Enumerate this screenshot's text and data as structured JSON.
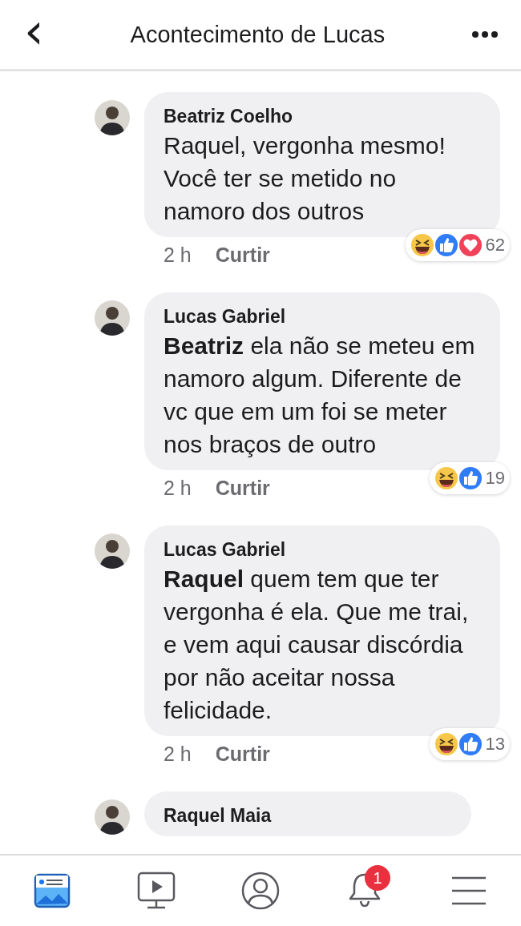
{
  "header": {
    "back": "‹",
    "title": "Acontecimento de Lucas"
  },
  "comments": [
    {
      "author": "Beatriz Coelho",
      "text": "Raquel, vergonha mesmo! Você ter se metido no namoro dos outros",
      "time": "2 h",
      "like": "Curtir",
      "reactions": [
        {
          "kind": "haha"
        },
        {
          "kind": "like"
        },
        {
          "kind": "love"
        }
      ],
      "count": "62"
    },
    {
      "author": "Lucas Gabriel",
      "text": "**Beatriz** ela não se meteu em namoro algum. Diferente de vc que em um foi se meter nos braços de outro",
      "time": "2 h",
      "like": "Curtir",
      "reactions": [
        {
          "kind": "haha"
        },
        {
          "kind": "like"
        }
      ],
      "count": "19"
    },
    {
      "author": "Lucas Gabriel",
      "text": "**Raquel** quem tem que ter vergonha é ela. Que me trai, e vem aqui causar discórdia por não aceitar nossa felicidade.",
      "time": "2 h",
      "like": "Curtir",
      "reactions": [
        {
          "kind": "haha"
        },
        {
          "kind": "like"
        }
      ],
      "count": "13"
    },
    {
      "author": "Raquel Maia"
    }
  ],
  "nav": [
    {
      "kind": "feed",
      "selected": true
    },
    {
      "kind": "video",
      "selected": false
    },
    {
      "kind": "profile",
      "selected": false
    },
    {
      "kind": "bell",
      "selected": false,
      "badge": "1"
    },
    {
      "kind": "menu",
      "selected": false
    }
  ]
}
